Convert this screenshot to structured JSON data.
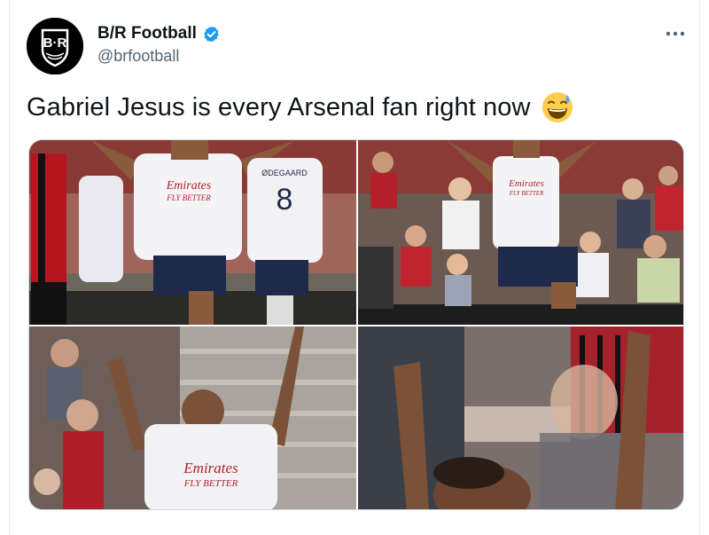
{
  "tweet": {
    "display_name": "B/R Football",
    "handle": "@brfootball",
    "text": "Gabriel Jesus is every Arsenal fan right now",
    "avatar_text": "B·R",
    "more_icon": "more-horizontal-icon",
    "verified_icon": "verified-badge-icon",
    "emoji": "grinning-face-with-sweat-emoji"
  },
  "media": {
    "photos": [
      {
        "description": "photo-celebration-1",
        "shirt_sponsor": "Emirates",
        "shirt_tagline": "FLY BETTER",
        "teammate_number": "8",
        "teammate_name": "ØDEGAARD"
      },
      {
        "description": "photo-celebration-2",
        "shirt_sponsor": "Emirates",
        "shirt_tagline": "FLY BETTER"
      },
      {
        "description": "photo-celebration-3",
        "shirt_sponsor": "Emirates",
        "shirt_tagline": "FLY BETTER"
      },
      {
        "description": "photo-celebration-4"
      }
    ]
  },
  "colors": {
    "verified_blue": "#1d9bf0",
    "text_primary": "#0f1419",
    "text_secondary": "#536471",
    "border": "#cfd9de"
  }
}
